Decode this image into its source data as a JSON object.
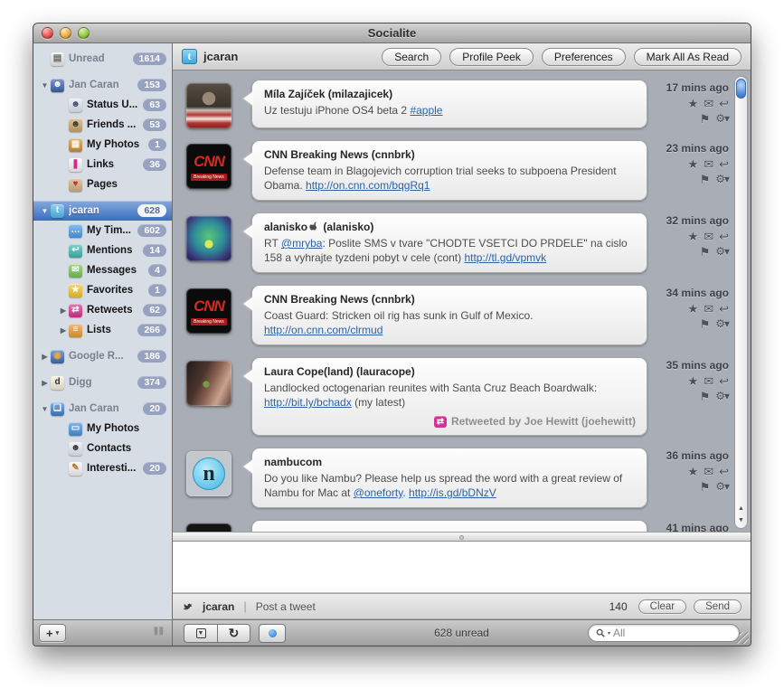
{
  "window": {
    "title": "Socialite"
  },
  "icons": {
    "disc_open": "▼",
    "disc_closed": "▶",
    "star": "★",
    "envelope": "✉",
    "reply": "↩",
    "flag": "⚑",
    "gear": "⚙",
    "gear_caret": "▾",
    "retweet_badge": "⇄",
    "refresh": "↻",
    "box_arrow": "▼",
    "scroll_up": "▲",
    "scroll_down": "▼",
    "plus": "+",
    "caret_down": "▾",
    "grip": "⦀⦀",
    "twitter_letter": "t"
  },
  "colors": {
    "selection_blue_top": "#85aadf",
    "selection_blue_bottom": "#3b6cbe",
    "badge": "#96a2c0",
    "list_background": "#a9aeb6",
    "link": "#2d62a8",
    "retweet_pink": "#d5319a",
    "twitter_blue": "#55b8ea"
  },
  "header": {
    "title": "jcaran",
    "buttons": [
      {
        "label": "Search"
      },
      {
        "label": "Profile Peek"
      },
      {
        "label": "Preferences"
      },
      {
        "label": "Mark All As Read"
      }
    ]
  },
  "sidebar": {
    "items": [
      {
        "id": "unread",
        "label": "Unread",
        "badge": "1614",
        "lvl": 0,
        "disc": "",
        "dim": true,
        "sel": false,
        "gap": false,
        "icon": "inbox-stack-icon",
        "g": "▤",
        "gb": "#ececec",
        "gc": "#666"
      },
      {
        "id": "jan-caran-facebook",
        "label": "Jan Caran",
        "badge": "153",
        "lvl": 0,
        "disc": "open",
        "dim": true,
        "sel": false,
        "gap": true,
        "icon": "address-book-icon",
        "g": "☻",
        "gb": "#3f62a8",
        "gc": "#fff"
      },
      {
        "id": "status-updates",
        "label": "Status U...",
        "badge": "63",
        "lvl": 1,
        "disc": "",
        "dim": false,
        "sel": false,
        "gap": false,
        "icon": "status-bubble-icon",
        "g": "☻",
        "gb": "#dfe7f0",
        "gc": "#44506b"
      },
      {
        "id": "friends",
        "label": "Friends ...",
        "badge": "53",
        "lvl": 1,
        "disc": "",
        "dim": false,
        "sel": false,
        "gap": false,
        "icon": "friends-photo-icon",
        "g": "☻",
        "gb": "#c9a469",
        "gc": "#3a3a3a"
      },
      {
        "id": "my-photos-facebook",
        "label": "My Photos",
        "badge": "1",
        "lvl": 1,
        "disc": "",
        "dim": false,
        "sel": false,
        "gap": false,
        "icon": "photo-icon",
        "g": "▦",
        "gb": "#c98f3f",
        "gc": "#fff4d8"
      },
      {
        "id": "links",
        "label": "Links",
        "badge": "36",
        "lvl": 1,
        "disc": "",
        "dim": false,
        "sel": false,
        "gap": false,
        "icon": "bookmark-icon",
        "g": "❚",
        "gb": "#f5f5f5",
        "gc": "#cc2a8d"
      },
      {
        "id": "pages",
        "label": "Pages",
        "badge": "",
        "lvl": 1,
        "disc": "",
        "dim": false,
        "sel": false,
        "gap": false,
        "icon": "folder-heart-icon",
        "g": "♥",
        "gb": "#cfb084",
        "gc": "#c8352e"
      },
      {
        "id": "jcaran-twitter",
        "label": "jcaran",
        "badge": "628",
        "lvl": 0,
        "disc": "open",
        "dim": false,
        "sel": true,
        "gap": true,
        "icon": "twitter-icon",
        "g": "t",
        "gb": "#55b8ea",
        "gc": "#fff"
      },
      {
        "id": "my-timeline",
        "label": "My Tim...",
        "badge": "602",
        "lvl": 1,
        "disc": "",
        "dim": false,
        "sel": false,
        "gap": false,
        "icon": "timeline-bubble-icon",
        "g": "…",
        "gb": "#4a9de8",
        "gc": "#fff"
      },
      {
        "id": "mentions",
        "label": "Mentions",
        "badge": "14",
        "lvl": 1,
        "disc": "",
        "dim": false,
        "sel": false,
        "gap": false,
        "icon": "mention-bubble-icon",
        "g": "↩",
        "gb": "#3fb8ae",
        "gc": "#fff"
      },
      {
        "id": "messages",
        "label": "Messages",
        "badge": "4",
        "lvl": 1,
        "disc": "",
        "dim": false,
        "sel": false,
        "gap": false,
        "icon": "envelope-icon",
        "g": "✉",
        "gb": "#76c353",
        "gc": "#fff"
      },
      {
        "id": "favorites",
        "label": "Favorites",
        "badge": "1",
        "lvl": 1,
        "disc": "",
        "dim": false,
        "sel": false,
        "gap": false,
        "icon": "star-icon",
        "g": "★",
        "gb": "#f2c230",
        "gc": "#fff"
      },
      {
        "id": "retweets",
        "label": "Retweets",
        "badge": "62",
        "lvl": 1,
        "disc": "closed",
        "dim": false,
        "sel": false,
        "gap": false,
        "icon": "retweet-icon",
        "g": "⇄",
        "gb": "#d5318d",
        "gc": "#fff"
      },
      {
        "id": "lists",
        "label": "Lists",
        "badge": "266",
        "lvl": 1,
        "disc": "closed",
        "dim": false,
        "sel": false,
        "gap": false,
        "icon": "list-icon",
        "g": "≡",
        "gb": "#e8993a",
        "gc": "#fff"
      },
      {
        "id": "google-reader",
        "label": "Google R...",
        "badge": "186",
        "lvl": 0,
        "disc": "closed",
        "dim": true,
        "sel": false,
        "gap": true,
        "icon": "rss-icon",
        "g": "◉",
        "gb": "#3c6cb5",
        "gc": "#f0a83c"
      },
      {
        "id": "digg",
        "label": "Digg",
        "badge": "374",
        "lvl": 0,
        "disc": "closed",
        "dim": true,
        "sel": false,
        "gap": true,
        "icon": "digg-icon",
        "g": "d",
        "gb": "#f4efda",
        "gc": "#333"
      },
      {
        "id": "jan-caran-photos",
        "label": "Jan Caran",
        "badge": "20",
        "lvl": 0,
        "disc": "open",
        "dim": true,
        "sel": false,
        "gap": true,
        "icon": "photo-stack-icon",
        "g": "❏",
        "gb": "#3f7ecb",
        "gc": "#fff"
      },
      {
        "id": "my-photos-2",
        "label": "My Photos",
        "badge": "",
        "lvl": 1,
        "disc": "",
        "dim": false,
        "sel": false,
        "gap": false,
        "icon": "photo-icon",
        "g": "▭",
        "gb": "#4a90d9",
        "gc": "#fff"
      },
      {
        "id": "contacts",
        "label": "Contacts",
        "badge": "",
        "lvl": 1,
        "disc": "",
        "dim": false,
        "sel": false,
        "gap": false,
        "icon": "contact-monitor-icon",
        "g": "☻",
        "gb": "#e3e9f0",
        "gc": "#333"
      },
      {
        "id": "interesting",
        "label": "Interesti...",
        "badge": "20",
        "lvl": 1,
        "disc": "",
        "dim": false,
        "sel": false,
        "gap": false,
        "icon": "magic-wand-icon",
        "g": "✎",
        "gb": "#f5f5f5",
        "gc": "#b8762a"
      }
    ]
  },
  "tweets": [
    {
      "avatar": "milazajicek",
      "avatar_big": "",
      "avatar_small": "",
      "name": "Míla Zajíček (milazajicek)",
      "name_post": "",
      "apple_icon": false,
      "time": "17 mins ago",
      "segments": [
        {
          "t": "Uz testuju iPhone OS4 beta 2 "
        },
        {
          "t": "#apple",
          "link": true
        }
      ],
      "retweet": ""
    },
    {
      "avatar": "cnn",
      "avatar_big": "CNN",
      "avatar_small": "Breaking News",
      "name": "CNN Breaking News (cnnbrk)",
      "name_post": "",
      "apple_icon": false,
      "time": "23 mins ago",
      "segments": [
        {
          "t": "Defense team in Blagojevich corruption trial seeks to subpoena President Obama. "
        },
        {
          "t": "http://on.cnn.com/bqgRq1",
          "link": true
        }
      ],
      "retweet": ""
    },
    {
      "avatar": "alanisko",
      "avatar_big": "",
      "avatar_small": "",
      "name": "alanisko",
      "name_post": " (alanisko)",
      "apple_icon": true,
      "time": "32 mins ago",
      "segments": [
        {
          "t": "RT "
        },
        {
          "t": "@mryba",
          "link": true
        },
        {
          "t": ": Poslite SMS v tvare \"CHODTE VSETCI DO PRDELE\" na cislo 158 a vyhrajte tyzdeni pobyt v cele (cont) "
        },
        {
          "t": "http://tl.gd/vpmvk",
          "link": true
        }
      ],
      "retweet": ""
    },
    {
      "avatar": "cnn",
      "avatar_big": "CNN",
      "avatar_small": "Breaking News",
      "name": "CNN Breaking News (cnnbrk)",
      "name_post": "",
      "apple_icon": false,
      "time": "34 mins ago",
      "segments": [
        {
          "t": "Coast Guard: Stricken oil rig has sunk in Gulf of Mexico. "
        },
        {
          "t": "http://on.cnn.com/clrmud",
          "link": true
        }
      ],
      "retweet": ""
    },
    {
      "avatar": "lauracope",
      "avatar_big": "",
      "avatar_small": "",
      "name": "Laura Cope(land) (lauracope)",
      "name_post": "",
      "apple_icon": false,
      "time": "35 mins ago",
      "segments": [
        {
          "t": "Landlocked octogenarian reunites with Santa Cruz Beach Boardwalk: "
        },
        {
          "t": "http://bit.ly/bchadx",
          "link": true
        },
        {
          "t": " (my latest)"
        }
      ],
      "retweet": "Retweeted by Joe Hewitt (joehewitt)"
    },
    {
      "avatar": "nambu",
      "avatar_big": "n",
      "avatar_small": "",
      "name": "nambucom",
      "name_post": "",
      "apple_icon": false,
      "time": "36 mins ago",
      "segments": [
        {
          "t": "Do you like Nambu? Please help us spread the word with a great review of Nambu for Mac at "
        },
        {
          "t": "@oneforty",
          "link": true
        },
        {
          "t": ". "
        },
        {
          "t": "http://is.gd/bDNzV",
          "link": true
        }
      ],
      "retweet": ""
    },
    {
      "avatar": "dark",
      "avatar_big": "",
      "avatar_small": "",
      "name": "",
      "name_post": "",
      "apple_icon": false,
      "time": "41 mins ago",
      "segments": [
        {
          "t": ""
        }
      ],
      "retweet": ""
    }
  ],
  "compose": {
    "account": "jcaran",
    "divider": "|",
    "prompt": "Post a tweet",
    "char_count": "140",
    "clear_label": "Clear",
    "send_label": "Send",
    "text": ""
  },
  "statusbar": {
    "unread": "628 unread",
    "search_value": "All"
  }
}
